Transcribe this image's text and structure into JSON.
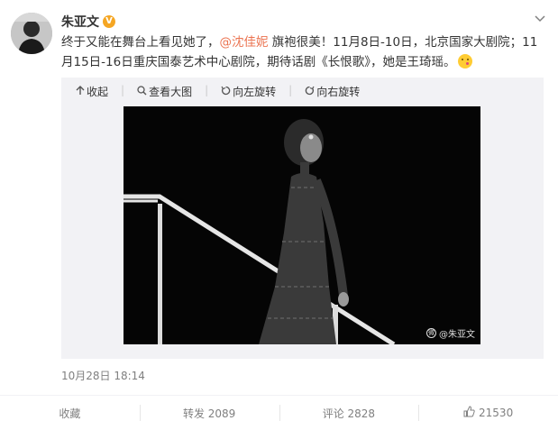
{
  "user": {
    "name": "朱亚文",
    "badge": "V"
  },
  "post": {
    "text_before": "终于又能在舞台上看见她了，",
    "mention": "@沈佳妮",
    "text_after": " 旗袍很美！11月8日-10日，北京国家大剧院；11月15日-16日重庆国泰艺术中心剧院，期待话剧《长恨歌》，她是王琦瑶。"
  },
  "media": {
    "toolbar": {
      "collapse": "收起",
      "view_large": "查看大图",
      "rotate_left": "向左旋转",
      "rotate_right": "向右旋转"
    },
    "watermark": "@朱亚文"
  },
  "timestamp": "10月28日 18:14",
  "actions": {
    "favorite": "收藏",
    "repost": "转发 2089",
    "comment": "评论 2828",
    "like": "21530"
  },
  "colors": {
    "mention": "#eb7350",
    "badge": "#f5a623",
    "media_bg": "#f2f2f5"
  }
}
